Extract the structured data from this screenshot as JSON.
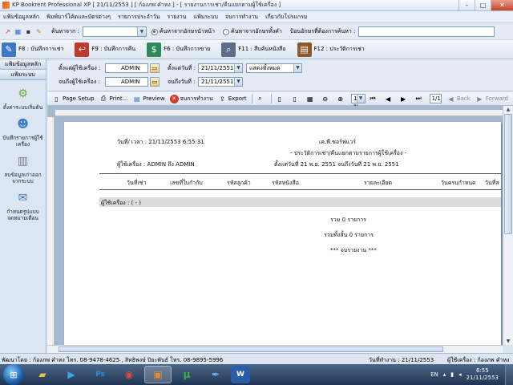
{
  "window": {
    "title": "KP Bookrent Professional XP [ 21/11/2553 ] [ ก้องภพ คำหง ] - [ รายงานการเช่า/คืนแยกตามผู้ใช้เครื่อง ]",
    "minimize": "–",
    "maximize": "□",
    "close": "✕"
  },
  "menu": [
    "แฟ้มข้อมูลหลัก",
    "พิมพ์บาร์โค้ดและบัตรต่างๆ",
    "รายการประจำวัน",
    "รายงาน",
    "แฟ้มระบบ",
    "จบการทำงาน",
    "เกี่ยวกับโปรแกรม"
  ],
  "search": {
    "label": "ค้นหาจาก :",
    "combo_value": "",
    "radio_prefix": "ค้นหาจากอักษรนำหน้า",
    "radio_any": "ค้นหาจากอักษรทั้งคำ",
    "input_label": "ป้อนอักษรที่ต้องการค้นหา :",
    "input_value": ""
  },
  "fkeys": [
    {
      "label": "F8 : บันทึกการเช่า",
      "icon": "✎",
      "color": "#3f77c8"
    },
    {
      "label": "F9 : บันทึกการคืน",
      "icon": "↩",
      "color": "#c0392b"
    },
    {
      "label": "F6 : บันทึกการขาย",
      "icon": "$",
      "color": "#2e8b57"
    },
    {
      "label": "F11 : สืบค้นหนังสือ",
      "icon": "⌕",
      "color": "#5d6d8a"
    },
    {
      "label": "F12 : ประวัติการเช่า",
      "icon": "▤",
      "color": "#8e5a2b"
    }
  ],
  "sidebar": {
    "head1": "แฟ้มข้อมูลหลัก",
    "head2": "แฟ้มระบบ",
    "items": [
      {
        "label": "ตั้งค่าระบบเริ่มต้น",
        "icon": "⚙",
        "color": "#6fa83c"
      },
      {
        "label": "บันทึกรายการผู้ใช้เครื่อง",
        "icon": "☻",
        "color": "#3d7fc4"
      },
      {
        "label": "ลบข้อมูลเก่าออกจากระบบ",
        "icon": "▥",
        "color": "#7a7f8c"
      },
      {
        "label": "กำหนดรูปแบบจดหมายเตือน",
        "icon": "✉",
        "color": "#4a6fa5"
      }
    ]
  },
  "filters": {
    "from_user_label": "ตั้งแต่ผู้ใช้เครื่อง :",
    "from_user_value": "ADMIN",
    "to_user_label": "จนถึงผู้ใช้เครื่อง :",
    "to_user_value": "ADMIN",
    "from_date_label": "ตั้งแต่วันที่ :",
    "from_date_value": "21/11/2551",
    "to_date_label": "จนถึงวันที่ :",
    "to_date_value": "21/11/2551",
    "show_value": "แสดงทั้งหมด"
  },
  "report_toolbar": {
    "page_setup": "Page Setup",
    "print": "Print...",
    "preview": "Preview",
    "close_job": "จบการทำงาน",
    "export": "Export",
    "zoom": "100 %",
    "page": "1/1",
    "back": "Back",
    "forward": "Forward"
  },
  "report": {
    "print_time": "วันที่/ เวลา : 21/11/2553 6:55:31",
    "company": "เค.พี.ซอร์ฟแวร์",
    "title": "- ประวัติการเช่า/คืนแยกตามรายการผู้ใช้เครื่อง -",
    "user_range": "ผู้ใช้เครื่อง : ADMIN ถึง ADMIN",
    "date_range": "ตั้งแต่วันที่ 21 พ.ย. 2551 จนถึงวันที่ 21 พ.ย. 2551",
    "columns": [
      "วันที่เช่า",
      "เลขที่ใบกำกับ",
      "รหัสลูกค้า",
      "รหัสหนังสือ",
      "รายละเอียด",
      "วันครบกำหนด",
      "วันที่ส"
    ],
    "group_label": "ผู้ใช้เครื่อง : ( - )",
    "subtotal": "รวม 0 รายการ",
    "grand_total": "รวมทั้งสิ้น 0 รายการ",
    "end": "*** จบรายงาน ***"
  },
  "status": {
    "developer": "พัฒนาโดย : ก้องภพ คำหง โทร. 08-9478-4625 , สิทธิพงษ์ ปิยะพันธ์ โทร. 08-9895-5996",
    "work_date": "วันที่ทำงาน : 21/11/2553",
    "user": "ผู้ใช้เครื่อง : ก้องภพ คำหง"
  },
  "taskbar": {
    "start_icon": "windows-orb",
    "apps": [
      {
        "name": "explorer",
        "icon": "▰",
        "color": "#f0c048"
      },
      {
        "name": "media",
        "icon": "▶",
        "color": "#3fa3e8"
      },
      {
        "name": "photoshop",
        "icon": "Ps",
        "color": "#2a8fd8"
      },
      {
        "name": "chrome",
        "icon": "◉",
        "color": "#e24b3b"
      },
      {
        "name": "bookrent",
        "icon": "▣",
        "color": "#e98c2e"
      },
      {
        "name": "utorrent",
        "icon": "µ",
        "color": "#3cb043"
      },
      {
        "name": "quill",
        "icon": "✒",
        "color": "#7ab8f5"
      },
      {
        "name": "word",
        "icon": "W",
        "color": "#2b5ca8"
      }
    ],
    "lang": "EN",
    "time": "6:55",
    "date": "21/11/2553"
  }
}
